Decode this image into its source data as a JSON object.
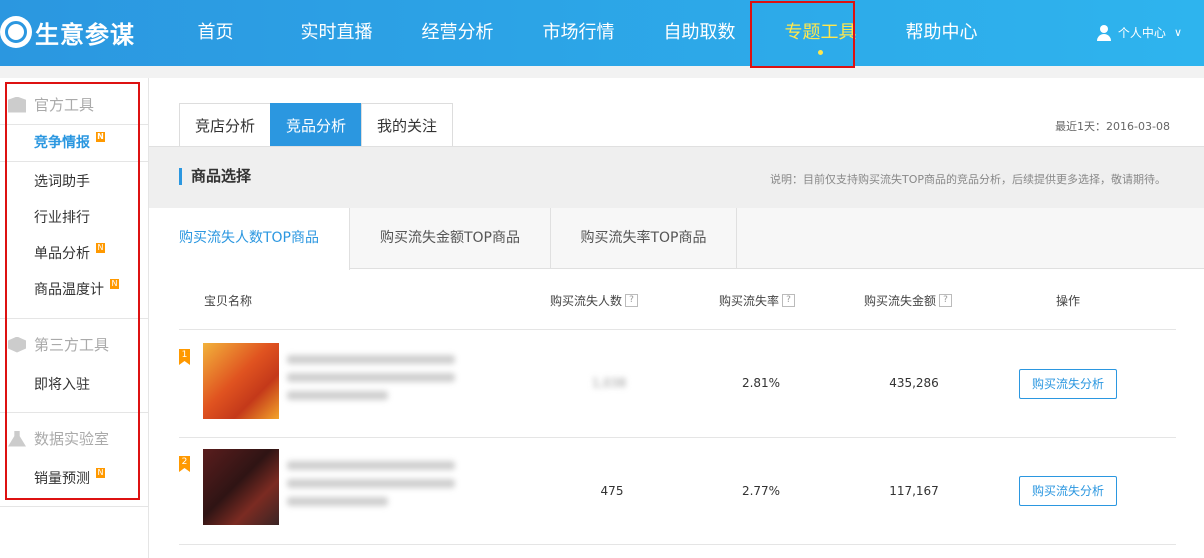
{
  "brand": {
    "name": "生意参谋"
  },
  "nav": {
    "items": [
      {
        "label": "首页"
      },
      {
        "label": "实时直播"
      },
      {
        "label": "经营分析"
      },
      {
        "label": "市场行情"
      },
      {
        "label": "自助取数"
      },
      {
        "label": "专题工具"
      },
      {
        "label": "帮助中心"
      }
    ],
    "active_index": 5,
    "active_color": "#ffe74d"
  },
  "user": {
    "label": "个人中心",
    "icon": "user-icon",
    "caret": "∨"
  },
  "sidebar": {
    "groups": [
      {
        "title": "官方工具",
        "icon": "building-icon",
        "items": [
          {
            "label": "竞争情报",
            "badge": "N",
            "active": true
          },
          {
            "label": "选词助手"
          },
          {
            "label": "行业排行"
          },
          {
            "label": "单品分析",
            "badge": "N"
          },
          {
            "label": "商品温度计",
            "badge": "N"
          }
        ]
      },
      {
        "title": "第三方工具",
        "icon": "cube-icon",
        "items": [
          {
            "label": "即将入驻"
          }
        ]
      },
      {
        "title": "数据实验室",
        "icon": "flask-icon",
        "items": [
          {
            "label": "销量预测",
            "badge": "N"
          }
        ]
      }
    ]
  },
  "main": {
    "tabs": [
      {
        "label": "竞店分析"
      },
      {
        "label": "竞品分析"
      },
      {
        "label": "我的关注"
      }
    ],
    "active_tab": 1,
    "date_text": "最近1天：2016-03-08",
    "section": {
      "title": "商品选择",
      "note": "说明：目前仅支持购买流失TOP商品的竞品分析，后续提供更多选择，敬请期待。"
    },
    "subtabs": [
      {
        "label": "购买流失人数TOP商品"
      },
      {
        "label": "购买流失金额TOP商品"
      },
      {
        "label": "购买流失率TOP商品"
      }
    ],
    "table": {
      "headers": {
        "name": "宝贝名称",
        "lost_users": "购买流失人数",
        "lost_rate": "购买流失率",
        "lost_amount": "购买流失金额",
        "action": "操作",
        "help": "?"
      },
      "rows": [
        {
          "rank": "1",
          "lost_users": "1,038",
          "lost_rate": "2.81%",
          "lost_amount": "435,286",
          "action": "购买流失分析"
        },
        {
          "rank": "2",
          "lost_users": "475",
          "lost_rate": "2.77%",
          "lost_amount": "117,167",
          "action": "购买流失分析"
        }
      ]
    }
  },
  "accent_color": "#2b97e0",
  "highlight_color": "#dd1111"
}
